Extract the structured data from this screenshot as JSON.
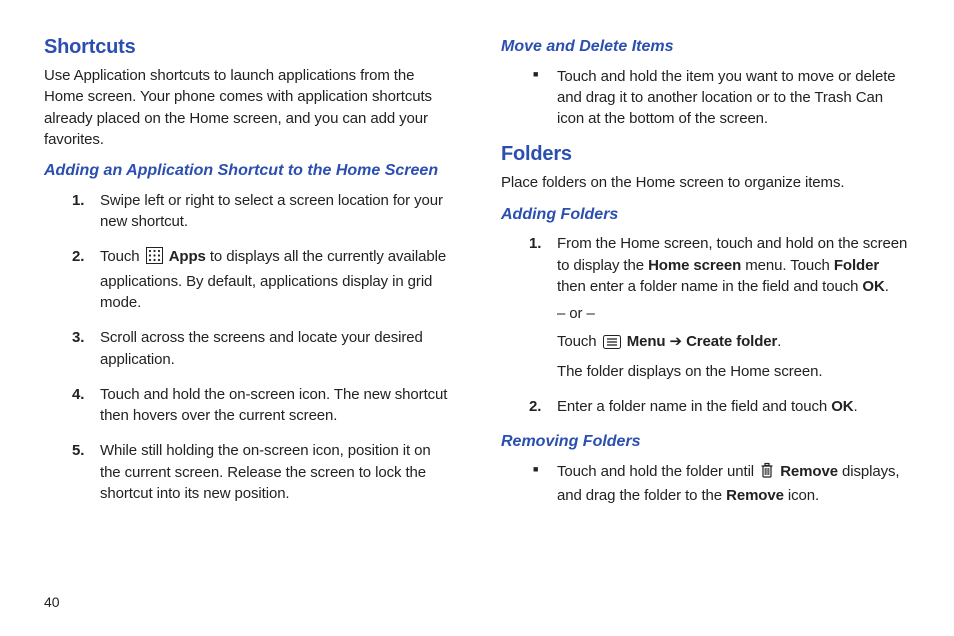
{
  "page_number": "40",
  "left": {
    "heading_shortcuts": "Shortcuts",
    "shortcuts_intro": "Use Application shortcuts to launch applications from the Home screen. Your phone comes with application shortcuts already placed on the Home screen, and you can add your favorites.",
    "subheading_add_shortcut": "Adding an Application Shortcut to the Home Screen",
    "steps": {
      "s1": "Swipe left or right to select a screen location for your new shortcut.",
      "s2_pre": "Touch ",
      "s2_bold": "Apps",
      "s2_post": " to displays all the currently available applications. By default, applications display in grid mode.",
      "s3": "Scroll across the screens and locate your desired application.",
      "s4": "Touch and hold the on-screen icon. The new shortcut then hovers over the current screen.",
      "s5": "While still holding the on-screen icon, position it on the current screen. Release the screen to lock the shortcut into its new position."
    },
    "nums": {
      "n1": "1.",
      "n2": "2.",
      "n3": "3.",
      "n4": "4.",
      "n5": "5."
    }
  },
  "right": {
    "subheading_move_delete": "Move and Delete Items",
    "move_delete_bullet": "Touch and hold the item you want to move or delete and drag it to another location or to the Trash Can icon at the bottom of the screen.",
    "heading_folders": "Folders",
    "folders_intro": "Place folders on the Home screen to organize items.",
    "subheading_adding_folders": "Adding Folders",
    "add_steps": {
      "s1_pre": "From the Home screen, touch and hold on the screen to display the ",
      "s1_b1": "Home screen",
      "s1_mid1": " menu. Touch ",
      "s1_b2": "Folder",
      "s1_mid2": " then enter a folder name in the field and touch ",
      "s1_b3": "OK",
      "s1_end": ".",
      "or": "– or –",
      "s1b_pre": "Touch ",
      "s1b_b1": "Menu",
      "s1b_arrow": " ➔ ",
      "s1b_b2": "Create folder",
      "s1b_end": ".",
      "s1c": "The folder displays on the Home screen.",
      "s2_pre": "Enter a folder name in the field and touch ",
      "s2_b1": "OK",
      "s2_end": "."
    },
    "nums": {
      "n1": "1.",
      "n2": "2."
    },
    "subheading_removing_folders": "Removing Folders",
    "remove_bullet_pre": "Touch and hold the folder until ",
    "remove_bullet_b1": "Remove",
    "remove_bullet_mid": " displays, and drag the folder to the ",
    "remove_bullet_b2": "Remove",
    "remove_bullet_end": " icon."
  }
}
